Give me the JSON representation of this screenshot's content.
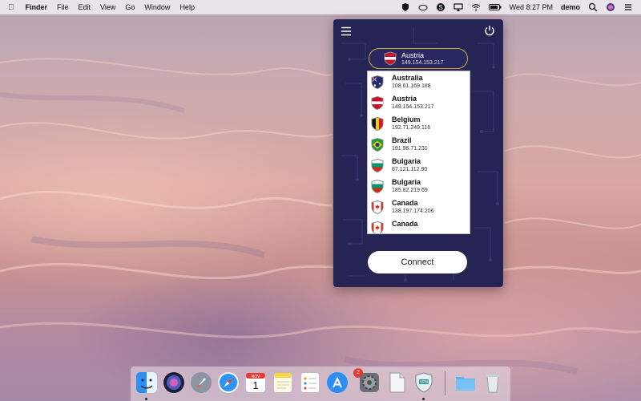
{
  "menubar": {
    "app_name": "Finder",
    "menus": [
      "File",
      "Edit",
      "View",
      "Go",
      "Window",
      "Help"
    ],
    "clock": "Wed 8:27 PM",
    "user": "demo"
  },
  "vpn": {
    "selected": {
      "country": "Austria",
      "ip": "149.154.153.217"
    },
    "servers": [
      {
        "country": "Australia",
        "ip": "108.61.169.188",
        "flag": "australia-flag-icon"
      },
      {
        "country": "Austria",
        "ip": "149.154.153.217",
        "flag": "austria-flag-icon"
      },
      {
        "country": "Belgium",
        "ip": "192.71.249.116",
        "flag": "belgium-flag-icon"
      },
      {
        "country": "Brazil",
        "ip": "191.96.71.231",
        "flag": "brazil-flag-icon"
      },
      {
        "country": "Bulgaria",
        "ip": "87.121.112.90",
        "flag": "bulgaria-flag-icon"
      },
      {
        "country": "Bulgaria",
        "ip": "185.82.219.69",
        "flag": "bulgaria-flag-icon"
      },
      {
        "country": "Canada",
        "ip": "138.197.174.206",
        "flag": "canada-flag-icon"
      },
      {
        "country": "Canada",
        "ip": "",
        "flag": "canada-flag-icon"
      }
    ],
    "connect_label": "Connect"
  },
  "dock": {
    "calendar_month": "NOV",
    "calendar_day": "1",
    "app_store_badge": "2"
  }
}
